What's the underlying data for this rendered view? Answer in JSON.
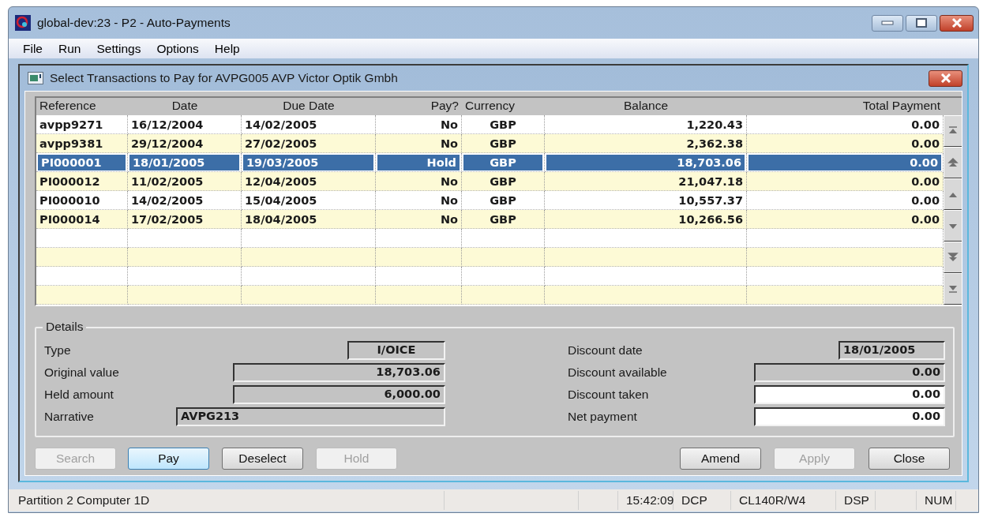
{
  "window": {
    "title": "global-dev:23 - P2 - Auto-Payments"
  },
  "menu": [
    "File",
    "Run",
    "Settings",
    "Options",
    "Help"
  ],
  "dialog": {
    "title": "Select Transactions to Pay for AVPG005 AVP Victor Optik Gmbh",
    "table": {
      "columns": [
        "Reference",
        "Date",
        "Due Date",
        "Pay?",
        "Currency",
        "Balance",
        "Total Payment"
      ],
      "rows": [
        {
          "reference": "avpp9271",
          "date": "16/12/2004",
          "due_date": "14/02/2005",
          "pay": "No",
          "currency": "GBP",
          "balance": "1,220.43",
          "total_payment": "0.00",
          "selected": false
        },
        {
          "reference": "avpp9381",
          "date": "29/12/2004",
          "due_date": "27/02/2005",
          "pay": "No",
          "currency": "GBP",
          "balance": "2,362.38",
          "total_payment": "0.00",
          "selected": false
        },
        {
          "reference": "PI000001",
          "date": "18/01/2005",
          "due_date": "19/03/2005",
          "pay": "Hold",
          "currency": "GBP",
          "balance": "18,703.06",
          "total_payment": "0.00",
          "selected": true
        },
        {
          "reference": "PI000012",
          "date": "11/02/2005",
          "due_date": "12/04/2005",
          "pay": "No",
          "currency": "GBP",
          "balance": "21,047.18",
          "total_payment": "0.00",
          "selected": false
        },
        {
          "reference": "PI000010",
          "date": "14/02/2005",
          "due_date": "15/04/2005",
          "pay": "No",
          "currency": "GBP",
          "balance": "10,557.37",
          "total_payment": "0.00",
          "selected": false
        },
        {
          "reference": "PI000014",
          "date": "17/02/2005",
          "due_date": "18/04/2005",
          "pay": "No",
          "currency": "GBP",
          "balance": "10,266.56",
          "total_payment": "0.00",
          "selected": false
        }
      ]
    },
    "details": {
      "title": "Details",
      "left": [
        {
          "label": "Type",
          "value": "I/OICE",
          "editable": false
        },
        {
          "label": "Original value",
          "value": "18,703.06",
          "editable": false
        },
        {
          "label": "Held amount",
          "value": "6,000.00",
          "editable": false
        },
        {
          "label": "Narrative",
          "value": "AVPG213",
          "editable": false
        }
      ],
      "right": [
        {
          "label": "Discount date",
          "value": "18/01/2005",
          "editable": false
        },
        {
          "label": "Discount available",
          "value": "0.00",
          "editable": false
        },
        {
          "label": "Discount taken",
          "value": "0.00",
          "editable": true
        },
        {
          "label": "Net payment",
          "value": "0.00",
          "editable": true
        }
      ]
    },
    "buttons": [
      {
        "label": "Search",
        "disabled": true,
        "default": false
      },
      {
        "label": "Pay",
        "disabled": false,
        "default": true
      },
      {
        "label": "Deselect",
        "disabled": false,
        "default": false
      },
      {
        "label": "Hold",
        "disabled": true,
        "default": false
      },
      {
        "label": "Amend",
        "disabled": false,
        "default": false
      },
      {
        "label": "Apply",
        "disabled": true,
        "default": false
      },
      {
        "label": "Close",
        "disabled": false,
        "default": false
      }
    ]
  },
  "status_bar": [
    "Partition 2 Computer 1D",
    "15:42:09",
    "DCP",
    "CL140R/W4",
    "DSP",
    "NUM"
  ]
}
